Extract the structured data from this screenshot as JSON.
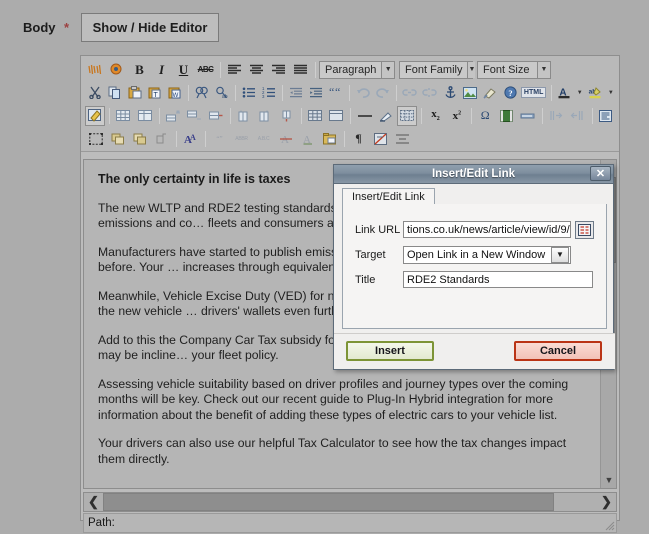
{
  "field": {
    "label": "Body",
    "required_marker": "*",
    "toggle_editor_label": "Show / Hide Editor"
  },
  "toolbar": {
    "selects": [
      {
        "name": "paragraph",
        "value": "Paragraph"
      },
      {
        "name": "font-family",
        "value": "Font Family"
      },
      {
        "name": "font-size",
        "value": "Font Size"
      }
    ],
    "row1": [
      {
        "icon": "spellcheck-icon",
        "label": ""
      },
      {
        "icon": "spellcheck-options-icon",
        "label": ""
      },
      {
        "icon": "bold-icon",
        "label": "B"
      },
      {
        "icon": "italic-icon",
        "label": "I"
      },
      {
        "icon": "underline-icon",
        "label": "U"
      },
      {
        "icon": "strikethrough-icon",
        "label": "ABC"
      },
      {
        "icon": "align-left-icon",
        "label": ""
      },
      {
        "icon": "align-center-icon",
        "label": ""
      },
      {
        "icon": "align-right-icon",
        "label": ""
      },
      {
        "icon": "align-justify-icon",
        "label": ""
      }
    ],
    "row2": [
      {
        "icon": "cut-icon"
      },
      {
        "icon": "copy-icon"
      },
      {
        "icon": "paste-icon"
      },
      {
        "icon": "paste-as-text-icon"
      },
      {
        "icon": "paste-from-word-icon"
      },
      {
        "icon": "find-icon"
      },
      {
        "icon": "find-replace-icon"
      },
      {
        "icon": "bullet-list-icon"
      },
      {
        "icon": "numbered-list-icon"
      },
      {
        "icon": "outdent-icon"
      },
      {
        "icon": "indent-icon"
      },
      {
        "icon": "blockquote-icon"
      },
      {
        "icon": "undo-icon"
      },
      {
        "icon": "redo-icon"
      },
      {
        "icon": "unlink-icon"
      },
      {
        "icon": "link-icon"
      },
      {
        "icon": "anchor-icon"
      },
      {
        "icon": "insert-image-icon"
      },
      {
        "icon": "cleanup-icon"
      },
      {
        "icon": "help-icon"
      },
      {
        "icon": "html-source-icon",
        "label": "HTML"
      },
      {
        "icon": "text-color-icon",
        "label": "A"
      },
      {
        "icon": "text-color-dropdown-icon"
      },
      {
        "icon": "background-color-icon",
        "label": "abc"
      },
      {
        "icon": "background-color-dropdown-icon"
      }
    ],
    "row3": [
      {
        "icon": "edit-table-icon"
      },
      {
        "icon": "insert-table-icon"
      },
      {
        "icon": "table-properties-icon"
      },
      {
        "icon": "insert-row-before-icon"
      },
      {
        "icon": "insert-row-after-icon"
      },
      {
        "icon": "delete-row-icon"
      },
      {
        "icon": "insert-column-before-icon"
      },
      {
        "icon": "insert-column-after-icon"
      },
      {
        "icon": "delete-column-icon"
      },
      {
        "icon": "split-cells-icon"
      },
      {
        "icon": "merge-cells-icon"
      },
      {
        "icon": "horizontal-rule-icon"
      },
      {
        "icon": "remove-format-icon"
      },
      {
        "icon": "visual-aid-icon"
      },
      {
        "icon": "subscript-icon",
        "label": "x"
      },
      {
        "icon": "superscript-icon",
        "label": "x"
      },
      {
        "icon": "special-char-icon",
        "label": "Ω"
      },
      {
        "icon": "insert-media-icon"
      },
      {
        "icon": "insert-hr-icon"
      },
      {
        "icon": "ltr-icon"
      },
      {
        "icon": "rtl-icon"
      },
      {
        "icon": "fullscreen-icon"
      }
    ],
    "row4": [
      {
        "icon": "select-all-icon"
      },
      {
        "icon": "insert-layer-icon"
      },
      {
        "icon": "move-layer-icon"
      },
      {
        "icon": "insert-div-icon"
      },
      {
        "icon": "style-props-icon"
      },
      {
        "icon": "quote-icon"
      },
      {
        "icon": "abbreviation-icon"
      },
      {
        "icon": "acronym-icon"
      },
      {
        "icon": "delete-text-icon"
      },
      {
        "icon": "insert-text-icon"
      },
      {
        "icon": "attributes-icon"
      },
      {
        "icon": "show-invisible-icon"
      },
      {
        "icon": "nonbreaking-icon"
      },
      {
        "icon": "pagebreak-icon"
      }
    ]
  },
  "document": {
    "heading": "The only certainty in life is taxes",
    "paragraphs": [
      "The new WLTP and RDE2 testing standards are n… manufacturers present accurate emissions and co… fleets and consumers alike to make better informe…",
      "Manufacturers have started to publish emissions fi… the calculations are 20% higher than before. Your … increases through equivalent hikes in the tax they p…",
      "Meanwhile, Vehicle Excise Duty (VED) for newly re… tax band above, unless they meet the new vehicle … drivers' wallets even further.",
      "Add to this the Company Car Tax subsidy for most… and it's easy to understand why you may be incline… your fleet policy.",
      "Assessing vehicle suitability based on driver profiles and journey types over the coming months will be key. Check out our recent guide to Plug-In Hybrid integration for more information about the benefit of adding these types of electric cars to your vehicle list.",
      "Your drivers can also use our helpful Tax Calculator to see how the tax changes impact them directly."
    ]
  },
  "statusbar": {
    "path_label": "Path:"
  },
  "dialog": {
    "title": "Insert/Edit Link",
    "close_label": "✕",
    "tab_label": "Insert/Edit Link",
    "fields": {
      "link_url": {
        "label": "Link URL",
        "value": "tions.co.uk/news/article/view/id/9/"
      },
      "target": {
        "label": "Target",
        "value": "Open Link in a New Window"
      },
      "title": {
        "label": "Title",
        "value": "RDE2 Standards"
      }
    },
    "browse_icon": "browse-files-icon",
    "buttons": {
      "insert": "Insert",
      "cancel": "Cancel"
    }
  },
  "colors": {
    "page_bg": "#acacac",
    "editor_bg": "#b5b5b5",
    "dialog_title_bar": "#7e8e9e",
    "insert_border": "#7d9436",
    "cancel_border": "#ba3416",
    "required_star": "#9c4040"
  }
}
